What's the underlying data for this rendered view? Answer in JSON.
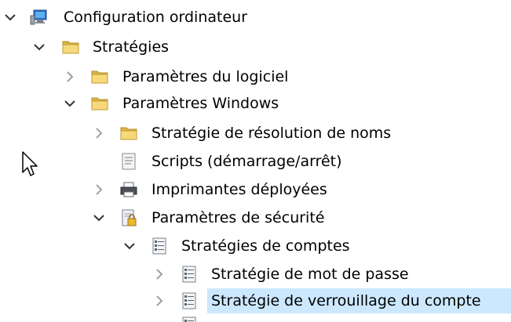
{
  "tree": {
    "items": [
      {
        "label": "Configuration ordinateur",
        "icon": "computer-icon",
        "expander": "expanded"
      },
      {
        "label": "Stratégies",
        "icon": "folder-icon",
        "expander": "expanded"
      },
      {
        "label": "Paramètres du logiciel",
        "icon": "folder-icon",
        "expander": "collapsed"
      },
      {
        "label": "Paramètres Windows",
        "icon": "folder-icon",
        "expander": "expanded"
      },
      {
        "label": "Stratégie de résolution de noms",
        "icon": "folder-icon",
        "expander": "collapsed"
      },
      {
        "label": "Scripts (démarrage/arrêt)",
        "icon": "script-icon",
        "expander": "none"
      },
      {
        "label": "Imprimantes déployées",
        "icon": "printer-icon",
        "expander": "collapsed"
      },
      {
        "label": "Paramètres de sécurité",
        "icon": "security-lock-icon",
        "expander": "expanded"
      },
      {
        "label": "Stratégies de comptes",
        "icon": "policy-icon",
        "expander": "expanded"
      },
      {
        "label": "Stratégie de mot de passe",
        "icon": "policy-icon",
        "expander": "collapsed"
      },
      {
        "label": "Stratégie de verrouillage du compte",
        "icon": "policy-icon",
        "expander": "collapsed",
        "selected": true
      }
    ]
  },
  "colors": {
    "selection": "#cce8ff",
    "folder": "#f2c94c",
    "chevron_expanded": "#333333",
    "chevron_collapsed": "#a0a0a0"
  }
}
